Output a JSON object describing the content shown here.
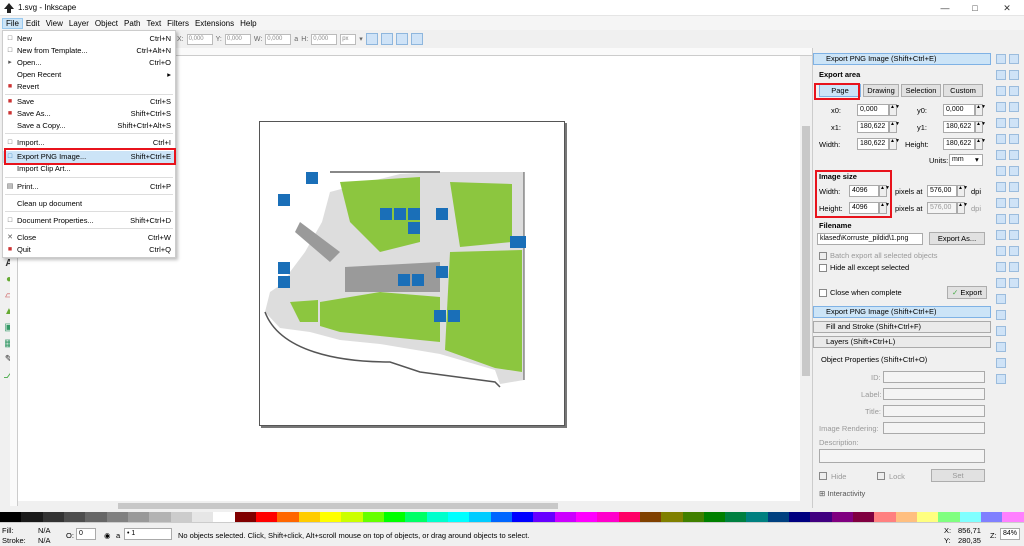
{
  "window": {
    "title": "1.svg - Inkscape",
    "controls": [
      "—",
      "□",
      "✕"
    ]
  },
  "menubar": [
    "File",
    "Edit",
    "View",
    "Layer",
    "Object",
    "Path",
    "Text",
    "Filters",
    "Extensions",
    "Help"
  ],
  "tool_controls": {
    "x_label": "X:",
    "x_value": "0,000",
    "y_label": "Y:",
    "y_value": "0,000",
    "w_label": "W:",
    "w_value": "0,000",
    "h_label": "H:",
    "h_value": "0,000",
    "unit": "px"
  },
  "file_menu": {
    "items": [
      {
        "label": "New",
        "shortcut": "Ctrl+N",
        "icon": "new-doc-icon"
      },
      {
        "label": "New from Template...",
        "shortcut": "Ctrl+Alt+N",
        "icon": "template-icon"
      },
      {
        "label": "Open...",
        "shortcut": "Ctrl+O",
        "icon": "open-icon"
      },
      {
        "label": "Open Recent",
        "shortcut": "",
        "icon": "",
        "submenu": true
      },
      {
        "label": "Revert",
        "shortcut": "",
        "icon": "revert-icon"
      },
      {
        "label": "Save",
        "shortcut": "Ctrl+S",
        "icon": "save-icon"
      },
      {
        "label": "Save As...",
        "shortcut": "Shift+Ctrl+S",
        "icon": "save-as-icon"
      },
      {
        "label": "Save a Copy...",
        "shortcut": "Shift+Ctrl+Alt+S",
        "icon": ""
      },
      {
        "label": "Import...",
        "shortcut": "Ctrl+I",
        "icon": "import-icon"
      },
      {
        "label": "Export PNG Image...",
        "shortcut": "Shift+Ctrl+E",
        "icon": "export-png-icon"
      },
      {
        "label": "Import Clip Art...",
        "shortcut": "",
        "icon": ""
      },
      {
        "label": "Print...",
        "shortcut": "Ctrl+P",
        "icon": "print-icon"
      },
      {
        "label": "Clean up document",
        "shortcut": "",
        "icon": ""
      },
      {
        "label": "Document Properties...",
        "shortcut": "Shift+Ctrl+D",
        "icon": "doc-props-icon"
      },
      {
        "label": "Close",
        "shortcut": "Ctrl+W",
        "icon": "close-icon"
      },
      {
        "label": "Quit",
        "shortcut": "Ctrl+Q",
        "icon": "quit-icon"
      }
    ]
  },
  "export_panel": {
    "title": "Export PNG Image (Shift+Ctrl+E)",
    "export_area_label": "Export area",
    "area_buttons": [
      "Page",
      "Drawing",
      "Selection",
      "Custom"
    ],
    "x0_label": "x0:",
    "x0": "0,000",
    "y0_label": "y0:",
    "y0": "0,000",
    "x1_label": "x1:",
    "x1": "180,622",
    "y1_label": "y1:",
    "y1": "180,622",
    "width_label": "Width:",
    "width": "180,622",
    "height_label": "Height:",
    "height": "180,622",
    "units_label": "Units:",
    "units": "mm",
    "image_size_label": "Image size",
    "img_width_label": "Width:",
    "img_width": "4096",
    "img_height_label": "Height:",
    "img_height": "4096",
    "pixels_at": "pixels at",
    "dpi_w": "576,00",
    "dpi_h": "576,00",
    "dpi": "dpi",
    "filename_label": "Filename",
    "filename": "klased\\Korruste_pildid\\1.png",
    "export_as": "Export As...",
    "batch_export": "Batch export all selected objects",
    "hide_all": "Hide all except selected",
    "close_when_complete": "Close when complete",
    "export_button": "Export"
  },
  "dock_sections": [
    "Export PNG Image (Shift+Ctrl+E)",
    "Fill and Stroke (Shift+Ctrl+F)",
    "Layers (Shift+Ctrl+L)"
  ],
  "object_props": {
    "title": "Object Properties (Shift+Ctrl+O)",
    "id": "ID:",
    "label": "Label:",
    "title_field": "Title:",
    "image_rendering": "Image Rendering:",
    "description": "Description:",
    "hide": "Hide",
    "lock": "Lock",
    "set": "Set",
    "interactivity": "Interactivity"
  },
  "status": {
    "fill_label": "Fill:",
    "fill_value": "N/A",
    "stroke_label": "Stroke:",
    "stroke_value": "N/A",
    "opacity_label": "O:",
    "opacity_value": "0",
    "layer": "• 1",
    "message": "No objects selected. Click, Shift+click, Alt+scroll mouse on top of objects, or drag around objects to select.",
    "x_label": "X:",
    "x_coord": "856,71",
    "y_label": "Y:",
    "y_coord": "280,35",
    "zoom_label": "Z:",
    "zoom": "84%"
  },
  "colors": {
    "highlight_red": "#e8131c",
    "map_green": "#8cc63f",
    "map_gray": "#c8c8c8",
    "icon_blue": "#1a6fb8"
  }
}
